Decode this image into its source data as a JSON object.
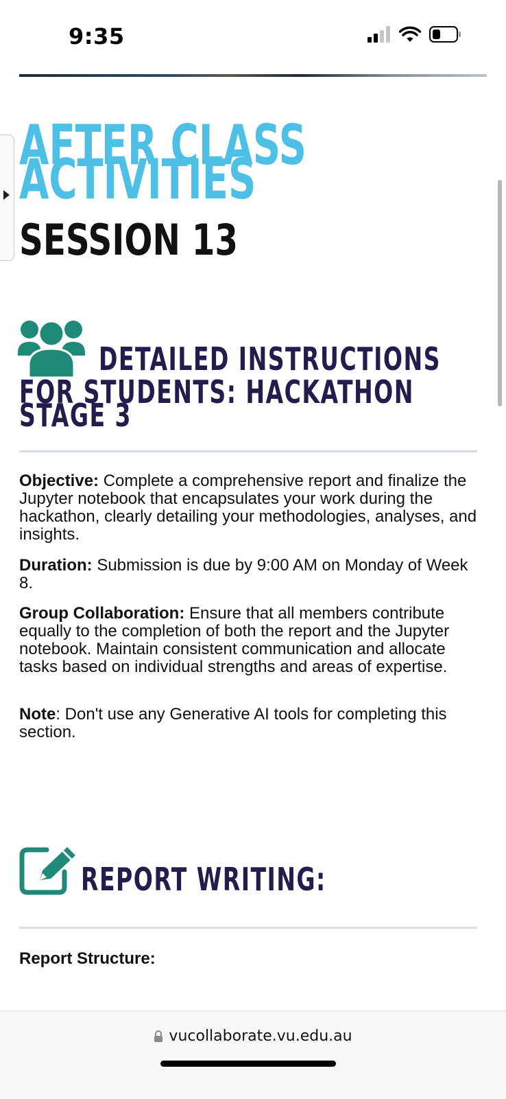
{
  "status_bar": {
    "time": "9:35",
    "icons": [
      "cellular-signal-icon",
      "wifi-icon",
      "battery-icon"
    ]
  },
  "page": {
    "title_line1": "AFTER CLASS",
    "title_line2": "ACTIVITIES",
    "session": "SESSION 13"
  },
  "section_instructions": {
    "icon": "group-users-icon",
    "title_line1": "DETAILED INSTRUCTIONS",
    "title_line2": "FOR STUDENTS: HACKATHON",
    "title_line3": "STAGE 3"
  },
  "paragraphs": {
    "objective_label": "Objective:",
    "objective_text": " Complete a comprehensive report and finalize the Jupyter notebook that encapsulates your work during the hackathon, clearly detailing your methodologies, analyses, and insights.",
    "duration_label": "Duration:",
    "duration_text": " Submission is due by 9:00 AM on Monday of Week 8.",
    "group_label": "Group Collaboration:",
    "group_text": " Ensure that all members contribute equally to the completion of both the report and the Jupyter notebook. Maintain consistent communication and allocate tasks based on individual strengths and areas of expertise.",
    "note_label": "Note",
    "note_text": ": Don't use any Generative AI tools for completing this section."
  },
  "section_report": {
    "icon": "edit-pencil-icon",
    "title": "REPORT WRITING:",
    "subheading": "Report Structure:"
  },
  "browser": {
    "url": "vucollaborate.vu.edu.au"
  },
  "colors": {
    "title_cyan": "#4fc0e5",
    "heading_navy": "#231c4d",
    "icon_teal": "#1f8a78"
  }
}
